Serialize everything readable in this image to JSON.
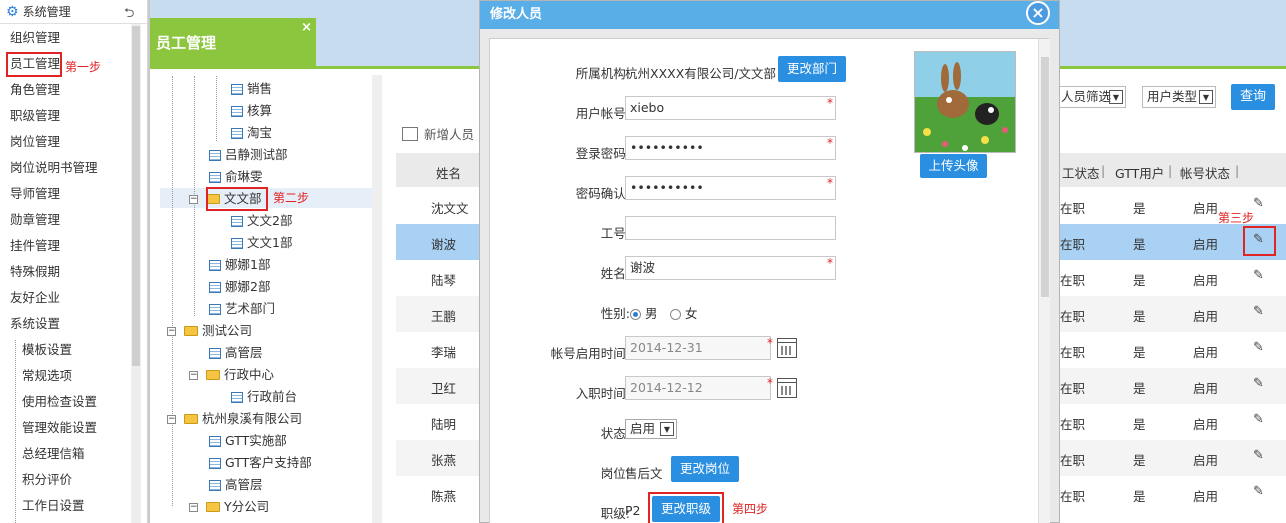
{
  "sidebar": {
    "title": "系统管理",
    "items": [
      "组织管理",
      "员工管理",
      "角色管理",
      "职级管理",
      "岗位管理",
      "岗位说明书管理",
      "导师管理",
      "勋章管理",
      "挂件管理",
      "特殊假期",
      "友好企业",
      "系统设置"
    ],
    "sub_items": [
      "模板设置",
      "常规选项",
      "使用检查设置",
      "管理效能设置",
      "总经理信箱",
      "积分评价",
      "工作日设置"
    ]
  },
  "steps": {
    "step1": "第一步",
    "step2": "第二步",
    "step3": "第三步",
    "step4": "第四步"
  },
  "tab": {
    "title": "员工管理",
    "close": "×"
  },
  "tree": {
    "nodes": [
      "销售",
      "核算",
      "淘宝",
      "吕静测试部",
      "俞琳雯",
      "文文部",
      "文文2部",
      "文文1部",
      "娜娜1部",
      "娜娜2部",
      "艺术部门",
      "测试公司",
      "高管层",
      "行政中心",
      "行政前台",
      "杭州泉溪有限公司",
      "GTT实施部",
      "GTT客户支持部",
      "高管层",
      "Y分公司"
    ]
  },
  "toolbar": {
    "add_label": "新增人员"
  },
  "filters": {
    "person_filter": "人员筛选",
    "user_type": "用户类型",
    "query": "查询"
  },
  "table": {
    "headers": {
      "name": "姓名",
      "status": "工状态",
      "gtt": "GTT用户",
      "account": "帐号状态"
    },
    "rows": [
      {
        "name": "沈文文",
        "work": "在职",
        "gtt": "是",
        "acct": "启用"
      },
      {
        "name": "谢波",
        "work": "在职",
        "gtt": "是",
        "acct": "启用"
      },
      {
        "name": "陆琴",
        "work": "在职",
        "gtt": "是",
        "acct": "启用"
      },
      {
        "name": "王鹏",
        "work": "在职",
        "gtt": "是",
        "acct": "启用"
      },
      {
        "name": "李瑞",
        "work": "在职",
        "gtt": "是",
        "acct": "启用"
      },
      {
        "name": "卫红",
        "work": "在职",
        "gtt": "是",
        "acct": "启用"
      },
      {
        "name": "陆明",
        "work": "在职",
        "gtt": "是",
        "acct": "启用"
      },
      {
        "name": "张燕",
        "work": "在职",
        "gtt": "是",
        "acct": "启用"
      },
      {
        "name": "陈燕",
        "work": "在职",
        "gtt": "是",
        "acct": "启用"
      }
    ]
  },
  "modal": {
    "title": "修改人员",
    "close": "×",
    "org_label": "所属机构:",
    "org_value": "杭州XXXX有限公司/文文部",
    "change_dept": "更改部门",
    "account_label": "用户帐号:",
    "account_value": "xiebo",
    "password_label": "登录密码:",
    "password_value": "••••••••••",
    "confirm_label": "密码确认:",
    "confirm_value": "••••••••••",
    "jobno_label": "工号:",
    "jobno_value": "",
    "name_label": "姓名:",
    "name_value": "谢波",
    "gender_label": "性别:",
    "gender_male": "男",
    "gender_female": "女",
    "enable_date_label": "帐号启用时间:",
    "enable_date_value": "2014-12-31",
    "join_date_label": "入职时间:",
    "join_date_value": "2014-12-12",
    "state_label": "状态:",
    "state_value": "启用",
    "post_label": "岗位:",
    "post_value": "售后文",
    "change_post": "更改岗位",
    "rank_label": "职级:",
    "rank_value": "P2",
    "change_rank": "更改职级",
    "upload_avatar": "上传头像",
    "required_mark": "*"
  },
  "colors": {
    "accent_blue": "#2a8fe0",
    "tab_green": "#8cc63f",
    "step_red": "#e02424",
    "header_blue": "#5aaee8"
  }
}
